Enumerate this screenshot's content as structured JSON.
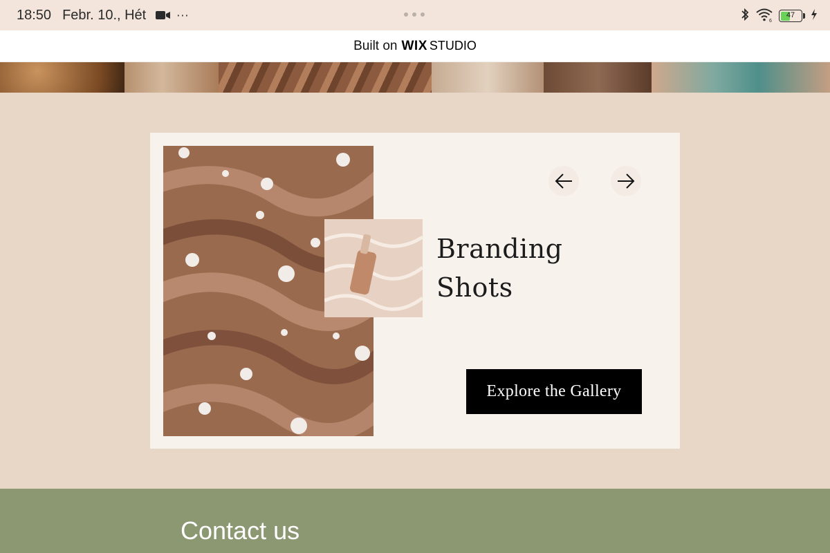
{
  "status_bar": {
    "time": "18:50",
    "date": "Febr. 10., Hét",
    "more": "···",
    "battery_level": "47",
    "battery_fraction": 0.47
  },
  "wix_banner": {
    "prefix": "Built on",
    "brand": "WIX",
    "product": "STUDIO"
  },
  "gallery_card": {
    "title_line1": "Branding",
    "title_line2": "Shots",
    "cta_label": "Explore the Gallery"
  },
  "contact": {
    "title": "Contact us"
  },
  "icons": {
    "prev": "arrow-left-icon",
    "next": "arrow-right-icon",
    "camera": "video-camera-icon",
    "bluetooth": "bluetooth-icon",
    "wifi": "wifi-icon",
    "charging": "charging-bolt-icon"
  },
  "colors": {
    "page_bg": "#e8d6c6",
    "card_bg": "#f8f2ec",
    "cta_bg": "#000000",
    "contact_bg": "#8c9872",
    "battery_fill": "#6bd15a"
  }
}
